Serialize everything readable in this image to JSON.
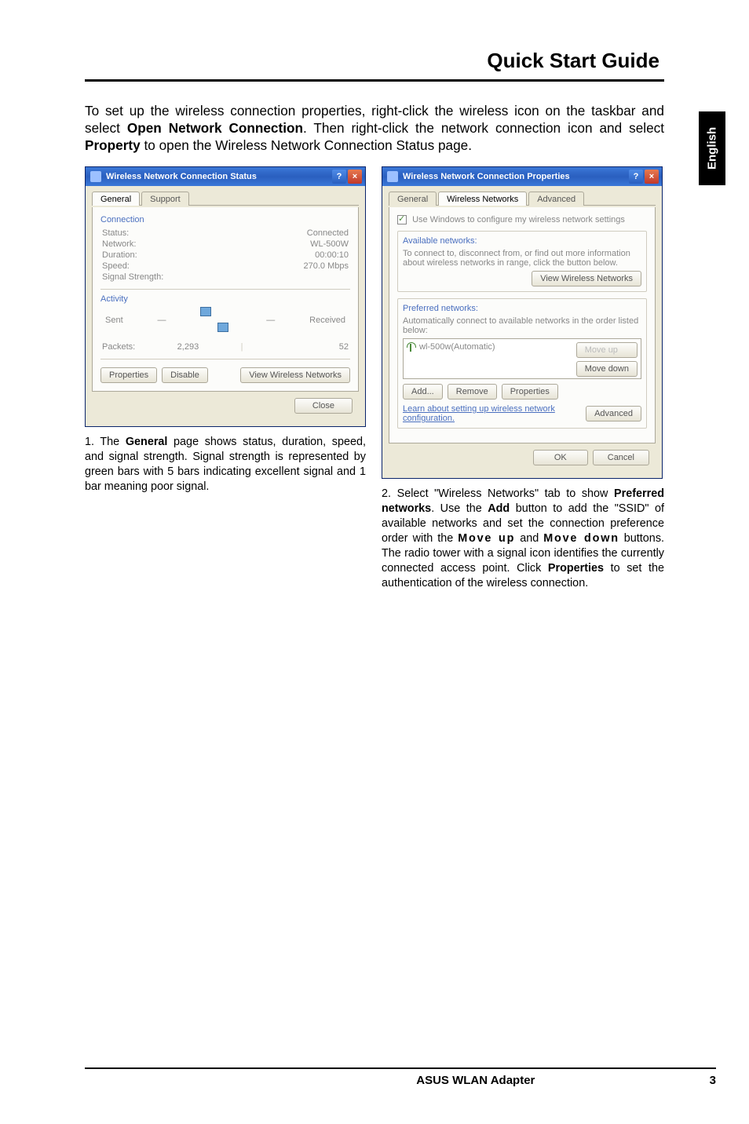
{
  "header": {
    "title": "Quick Start Guide"
  },
  "side_tab": "English",
  "intro": "To set up the wireless connection properties, right-click the wireless icon on the taskbar and select Open Network Connection. Then right-click the network connection icon and select Property to open the Wireless Network Connection Status page.",
  "intro_bold": {
    "b1": "Open Network Connection",
    "b2": "Property"
  },
  "status_dialog": {
    "title": "Wireless Network Connection Status",
    "tabs": {
      "general": "General",
      "support": "Support"
    },
    "section_connection": "Connection",
    "rows": {
      "status_k": "Status:",
      "status_v": "Connected",
      "network_k": "Network:",
      "network_v": "WL-500W",
      "duration_k": "Duration:",
      "duration_v": "00:00:10",
      "speed_k": "Speed:",
      "speed_v": "270.0 Mbps",
      "signal_k": "Signal Strength:"
    },
    "section_activity": "Activity",
    "activity": {
      "sent": "Sent",
      "received": "Received",
      "packets_k": "Packets:",
      "packets_sent": "2,293",
      "packets_recv": "52"
    },
    "buttons": {
      "properties": "Properties",
      "disable": "Disable",
      "view": "View Wireless Networks",
      "close": "Close"
    }
  },
  "props_dialog": {
    "title": "Wireless Network Connection Properties",
    "tabs": {
      "general": "General",
      "wireless": "Wireless Networks",
      "advanced": "Advanced"
    },
    "use_windows": "Use Windows to configure my wireless network settings",
    "available_title": "Available networks:",
    "available_text": "To connect to, disconnect from, or find out more information about wireless networks in range, click the button below.",
    "view_btn": "View Wireless Networks",
    "preferred_title": "Preferred networks:",
    "preferred_text": "Automatically connect to available networks in the order listed below:",
    "preferred_item": "wl-500w(Automatic)",
    "moveup": "Move up",
    "movedown": "Move down",
    "add": "Add...",
    "remove": "Remove",
    "properties": "Properties",
    "learn": "Learn about setting up wireless network configuration.",
    "advanced_btn": "Advanced",
    "ok": "OK",
    "cancel": "Cancel"
  },
  "caption1": {
    "num": "1.",
    "text": " The General page shows status, duration, speed, and signal strength. Signal strength is represented by green bars with 5 bars indicating excellent signal and 1 bar meaning poor signal.",
    "bold": "General"
  },
  "caption2": {
    "num": "2.",
    "text_a": " Select \"Wireless Networks\" tab to show ",
    "b1": "Preferred networks",
    "text_b": ". Use the ",
    "b2": "Add",
    "text_c": " button to add the \"SSID\" of available networks and set the connection preference order with the ",
    "b3": "Move up",
    "text_d": " and ",
    "b4": "Move down",
    "text_e": " buttons. The radio tower with a signal icon identifies the currently connected access point. Click ",
    "b5": "Properties",
    "text_f": " to set the authentication of the wireless connection."
  },
  "chart_data": {
    "type": "table",
    "title": "Wireless Network Connection Status — General tab",
    "rows": [
      {
        "label": "Status",
        "value": "Connected"
      },
      {
        "label": "Network",
        "value": "WL-500W"
      },
      {
        "label": "Duration",
        "value": "00:00:10"
      },
      {
        "label": "Speed",
        "value": "270.0 Mbps"
      },
      {
        "label": "Packets Sent",
        "value": 2293
      },
      {
        "label": "Packets Received",
        "value": 52
      }
    ]
  },
  "footer": {
    "product": "ASUS WLAN Adapter",
    "page": "3"
  }
}
